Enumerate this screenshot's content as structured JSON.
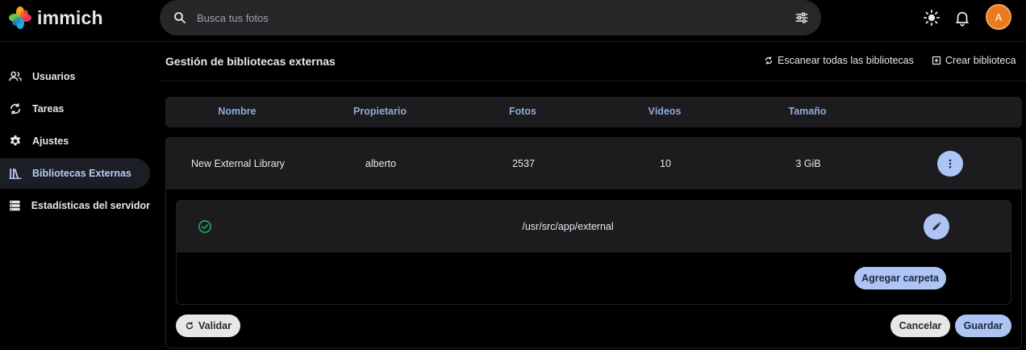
{
  "app": {
    "name": "immich"
  },
  "search": {
    "placeholder": "Busca tus fotos"
  },
  "user": {
    "avatar_initial": "A"
  },
  "sidebar": {
    "items": [
      {
        "label": "Usuarios",
        "icon": "users-icon"
      },
      {
        "label": "Tareas",
        "icon": "sync-icon"
      },
      {
        "label": "Ajustes",
        "icon": "gear-icon"
      },
      {
        "label": "Bibliotecas Externas",
        "icon": "library-icon",
        "active": true
      },
      {
        "label": "Estadísticas del servidor",
        "icon": "server-icon"
      }
    ]
  },
  "page": {
    "title": "Gestión de bibliotecas externas",
    "scan_all_label": "Escanear todas las bibliotecas",
    "create_label": "Crear biblioteca"
  },
  "table": {
    "headers": [
      "Nombre",
      "Propietario",
      "Fotos",
      "Vídeos",
      "Tamaño"
    ],
    "row": {
      "name": "New External Library",
      "owner": "alberto",
      "photos": "2537",
      "videos": "10",
      "size": "3 GiB"
    }
  },
  "folder": {
    "path": "/usr/src/app/external",
    "add_label": "Agregar carpeta"
  },
  "actions": {
    "validate_label": "Validar",
    "cancel_label": "Cancelar",
    "save_label": "Guardar"
  },
  "colors": {
    "accent": "#adc4f5",
    "header_text": "#8fa9dd",
    "avatar": "#ea7a1c",
    "success": "#22a55a"
  }
}
